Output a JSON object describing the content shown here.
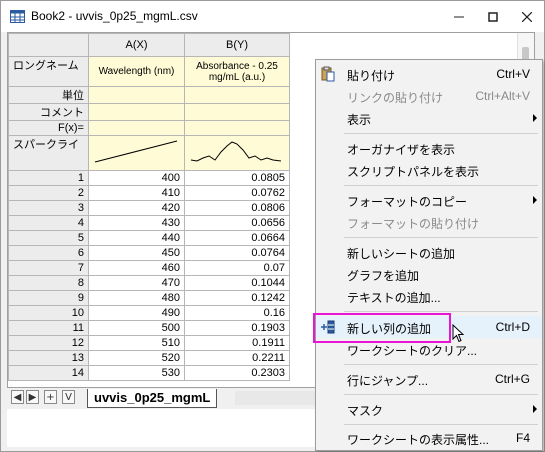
{
  "window": {
    "title": "Book2 - uvvis_0p25_mgmL.csv",
    "controls": [
      "minimize",
      "maximize",
      "close"
    ]
  },
  "sheet": {
    "col_headers": [
      "A(X)",
      "B(Y)"
    ],
    "label_rows": [
      {
        "label": "ロングネーム",
        "a": "Wavelength (nm)",
        "b": "Absorbance - 0.25 mg/mL (a.u.)"
      },
      {
        "label": "単位",
        "a": "",
        "b": ""
      },
      {
        "label": "コメント",
        "a": "",
        "b": ""
      },
      {
        "label": "F(x)=",
        "a": "",
        "b": ""
      },
      {
        "label": "スパークライ",
        "a": "",
        "b": ""
      }
    ],
    "rows": [
      {
        "n": "1",
        "a": "400",
        "b": "0.0805"
      },
      {
        "n": "2",
        "a": "410",
        "b": "0.0762"
      },
      {
        "n": "3",
        "a": "420",
        "b": "0.0806"
      },
      {
        "n": "4",
        "a": "430",
        "b": "0.0656"
      },
      {
        "n": "5",
        "a": "440",
        "b": "0.0664"
      },
      {
        "n": "6",
        "a": "450",
        "b": "0.0764"
      },
      {
        "n": "7",
        "a": "460",
        "b": "0.07"
      },
      {
        "n": "8",
        "a": "470",
        "b": "0.1044"
      },
      {
        "n": "9",
        "a": "480",
        "b": "0.1242"
      },
      {
        "n": "10",
        "a": "490",
        "b": "0.16"
      },
      {
        "n": "11",
        "a": "500",
        "b": "0.1903"
      },
      {
        "n": "12",
        "a": "510",
        "b": "0.1911"
      },
      {
        "n": "13",
        "a": "520",
        "b": "0.2211"
      },
      {
        "n": "14",
        "a": "530",
        "b": "0.2303"
      }
    ]
  },
  "tabbar": {
    "nav": [
      "◀",
      "▶",
      "+",
      "V"
    ],
    "sheet_tab": "uvvis_0p25_mgmL"
  },
  "context_menu": {
    "items": [
      {
        "id": "paste",
        "label": "貼り付け",
        "shortcut": "Ctrl+V",
        "disabled": false,
        "submenu": false
      },
      {
        "id": "paste-link",
        "label": "リンクの貼り付け",
        "shortcut": "Ctrl+Alt+V",
        "disabled": true,
        "submenu": false
      },
      {
        "id": "view",
        "label": "表示",
        "shortcut": "",
        "disabled": false,
        "submenu": true
      },
      {
        "id": "show-organizer",
        "label": "オーガナイザを表示",
        "shortcut": "",
        "disabled": false,
        "submenu": false
      },
      {
        "id": "show-script-panel",
        "label": "スクリプトパネルを表示",
        "shortcut": "",
        "disabled": false,
        "submenu": false
      },
      {
        "id": "copy-format",
        "label": "フォーマットのコピー",
        "shortcut": "",
        "disabled": false,
        "submenu": true
      },
      {
        "id": "paste-format",
        "label": "フォーマットの貼り付け",
        "shortcut": "",
        "disabled": true,
        "submenu": false
      },
      {
        "id": "add-sheet",
        "label": "新しいシートの追加",
        "shortcut": "",
        "disabled": false,
        "submenu": false
      },
      {
        "id": "add-graph",
        "label": "グラフを追加",
        "shortcut": "",
        "disabled": false,
        "submenu": false
      },
      {
        "id": "add-text",
        "label": "テキストの追加...",
        "shortcut": "",
        "disabled": false,
        "submenu": false
      },
      {
        "id": "add-column",
        "label": "新しい列の追加",
        "shortcut": "Ctrl+D",
        "disabled": false,
        "submenu": false
      },
      {
        "id": "clear-worksheet",
        "label": "ワークシートのクリア...",
        "shortcut": "",
        "disabled": false,
        "submenu": false
      },
      {
        "id": "goto-row",
        "label": "行にジャンプ...",
        "shortcut": "Ctrl+G",
        "disabled": false,
        "submenu": false
      },
      {
        "id": "mask",
        "label": "マスク",
        "shortcut": "",
        "disabled": false,
        "submenu": true
      },
      {
        "id": "worksheet-props",
        "label": "ワークシートの表示属性...",
        "shortcut": "F4",
        "disabled": false,
        "submenu": false
      }
    ]
  },
  "colors": {
    "label_row_bg": "#fffbd6",
    "highlight_box": "#e814d6",
    "menu_hover": "#e5f1fb"
  }
}
